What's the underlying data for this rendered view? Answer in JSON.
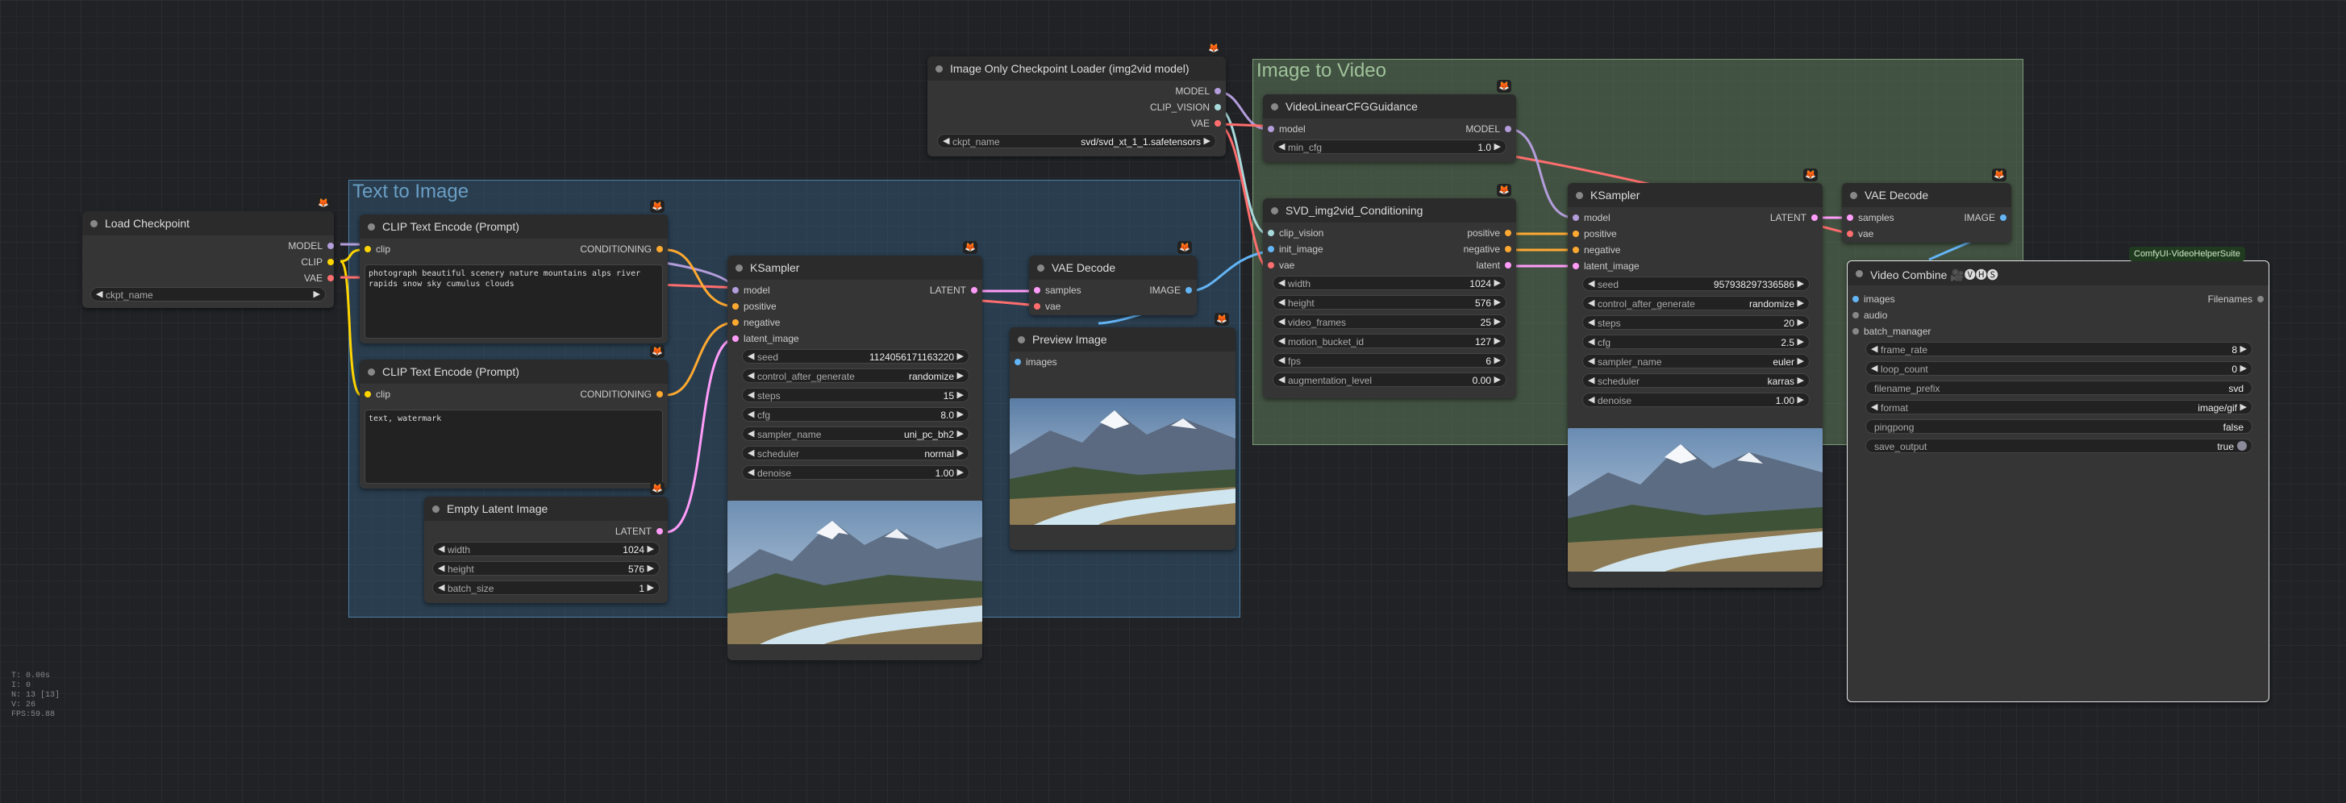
{
  "groups": {
    "t2i": {
      "title": "Text to Image",
      "color": "#355f80"
    },
    "i2v": {
      "title": "Image to Video",
      "color": "#5e7a5a"
    }
  },
  "badge_icon": "fox-badge-icon",
  "nodes": {
    "load_checkpoint": {
      "title": "Load Checkpoint",
      "outputs": [
        "MODEL",
        "CLIP",
        "VAE"
      ],
      "ckpt_text": "ckpt_name"
    },
    "clip_pos": {
      "title": "CLIP Text Encode (Prompt)",
      "input": "clip",
      "output": "CONDITIONING",
      "text": "photograph beautiful scenery nature mountains alps river rapids snow sky cumulus clouds"
    },
    "clip_neg": {
      "title": "CLIP Text Encode (Prompt)",
      "input": "clip",
      "output": "CONDITIONING",
      "text": "text, watermark"
    },
    "empty_latent": {
      "title": "Empty Latent Image",
      "output": "LATENT",
      "widgets": [
        {
          "label": "width",
          "value": "1024"
        },
        {
          "label": "height",
          "value": "576"
        },
        {
          "label": "batch_size",
          "value": "1"
        }
      ]
    },
    "ksampler1": {
      "title": "KSampler",
      "inputs": [
        "model",
        "positive",
        "negative",
        "latent_image"
      ],
      "output": "LATENT",
      "widgets": [
        {
          "label": "seed",
          "value": "1124056171163220"
        },
        {
          "label": "control_after_generate",
          "value": "randomize"
        },
        {
          "label": "steps",
          "value": "15"
        },
        {
          "label": "cfg",
          "value": "8.0"
        },
        {
          "label": "sampler_name",
          "value": "uni_pc_bh2"
        },
        {
          "label": "scheduler",
          "value": "normal"
        },
        {
          "label": "denoise",
          "value": "1.00"
        }
      ]
    },
    "vae_decode1": {
      "title": "VAE Decode",
      "inputs": [
        "samples",
        "vae"
      ],
      "output": "IMAGE"
    },
    "preview": {
      "title": "Preview Image",
      "input": "images"
    },
    "img_only_loader": {
      "title": "Image Only Checkpoint Loader (img2vid model)",
      "outputs": [
        "MODEL",
        "CLIP_VISION",
        "VAE"
      ],
      "widget": {
        "label": "ckpt_name",
        "value": "svd/svd_xt_1_1.safetensors"
      }
    },
    "video_cfg": {
      "title": "VideoLinearCFGGuidance",
      "input": "model",
      "output": "MODEL",
      "widget": {
        "label": "min_cfg",
        "value": "1.0"
      }
    },
    "svd_cond": {
      "title": "SVD_img2vid_Conditioning",
      "inputs": [
        "clip_vision",
        "init_image",
        "vae"
      ],
      "outputs": [
        "positive",
        "negative",
        "latent"
      ],
      "widgets": [
        {
          "label": "width",
          "value": "1024"
        },
        {
          "label": "height",
          "value": "576"
        },
        {
          "label": "video_frames",
          "value": "25"
        },
        {
          "label": "motion_bucket_id",
          "value": "127"
        },
        {
          "label": "fps",
          "value": "6"
        },
        {
          "label": "augmentation_level",
          "value": "0.00"
        }
      ]
    },
    "ksampler2": {
      "title": "KSampler",
      "inputs": [
        "model",
        "positive",
        "negative",
        "latent_image"
      ],
      "output": "LATENT",
      "widgets": [
        {
          "label": "seed",
          "value": "957938297336586"
        },
        {
          "label": "control_after_generate",
          "value": "randomize"
        },
        {
          "label": "steps",
          "value": "20"
        },
        {
          "label": "cfg",
          "value": "2.5"
        },
        {
          "label": "sampler_name",
          "value": "euler"
        },
        {
          "label": "scheduler",
          "value": "karras"
        },
        {
          "label": "denoise",
          "value": "1.00"
        }
      ]
    },
    "vae_decode2": {
      "title": "VAE Decode",
      "inputs": [
        "samples",
        "vae"
      ],
      "output": "IMAGE"
    },
    "video_combine": {
      "title": "Video Combine 🎥🅥🅗🅢",
      "suite": "ComfyUI-VideoHelperSuite",
      "inputs": [
        "images",
        "audio",
        "batch_manager"
      ],
      "output": "Filenames",
      "widgets": [
        {
          "label": "frame_rate",
          "value": "8",
          "kind": "num"
        },
        {
          "label": "loop_count",
          "value": "0",
          "kind": "num"
        },
        {
          "label": "filename_prefix",
          "value": "svd",
          "kind": "text"
        },
        {
          "label": "format",
          "value": "image/gif",
          "kind": "num"
        },
        {
          "label": "pingpong",
          "value": "false",
          "kind": "text"
        },
        {
          "label": "save_output",
          "value": "true",
          "kind": "toggle"
        }
      ]
    }
  },
  "stats": [
    "T: 0.00s",
    "I: 0",
    "N: 13 [13]",
    "V: 26",
    "FPS:59.88"
  ],
  "colors": {
    "model": "#b39ddb",
    "clip": "#ffd500",
    "vae": "#ff6e6e",
    "conditioning": "#ffa931",
    "latent": "#ff9cf9",
    "image": "#64b5f6",
    "clip_vision": "#a8dadc"
  }
}
